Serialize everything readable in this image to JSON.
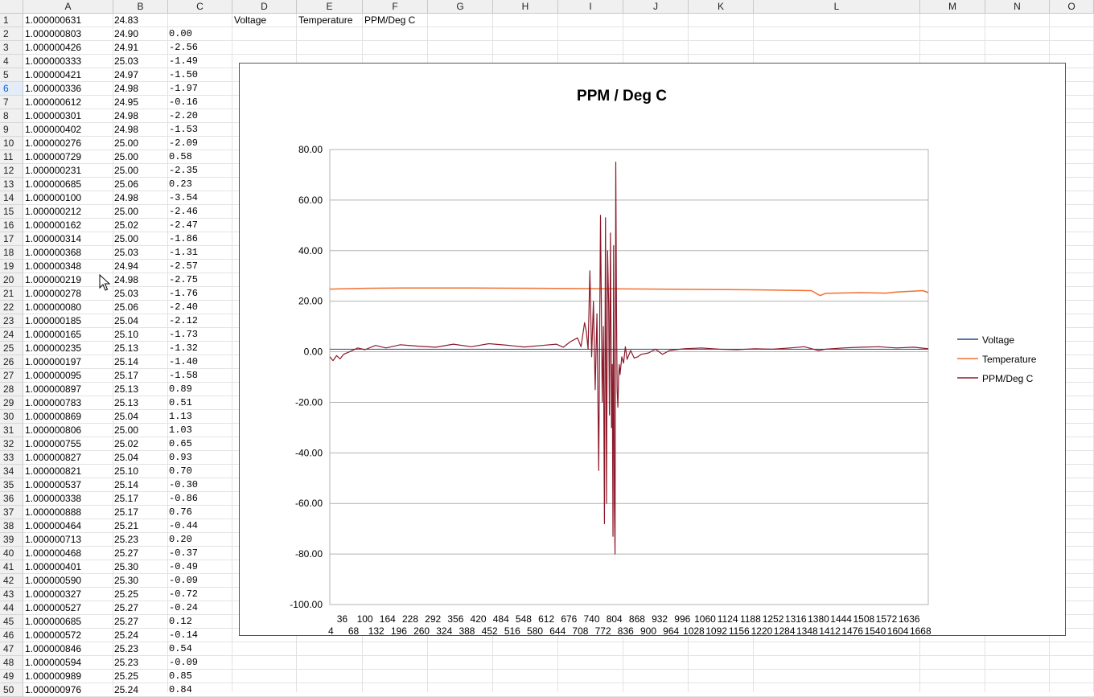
{
  "columns": [
    "A",
    "B",
    "C",
    "D",
    "E",
    "F",
    "G",
    "H",
    "I",
    "J",
    "K",
    "L",
    "M",
    "N",
    "O"
  ],
  "header_row": {
    "D": "Voltage",
    "E": "Temperature",
    "F": "PPM/Deg C"
  },
  "active_row": 6,
  "rows": [
    {
      "n": "1",
      "a": "1.000000631",
      "b": "24.83",
      "c": ""
    },
    {
      "n": "2",
      "a": "1.000000803",
      "b": "24.90",
      "c": "0.00"
    },
    {
      "n": "3",
      "a": "1.000000426",
      "b": "24.91",
      "c": "-2.56"
    },
    {
      "n": "4",
      "a": "1.000000333",
      "b": "25.03",
      "c": "-1.49"
    },
    {
      "n": "5",
      "a": "1.000000421",
      "b": "24.97",
      "c": "-1.50"
    },
    {
      "n": "6",
      "a": "1.000000336",
      "b": "24.98",
      "c": "-1.97"
    },
    {
      "n": "7",
      "a": "1.000000612",
      "b": "24.95",
      "c": "-0.16"
    },
    {
      "n": "8",
      "a": "1.000000301",
      "b": "24.98",
      "c": "-2.20"
    },
    {
      "n": "9",
      "a": "1.000000402",
      "b": "24.98",
      "c": "-1.53"
    },
    {
      "n": "10",
      "a": "1.000000276",
      "b": "25.00",
      "c": "-2.09"
    },
    {
      "n": "11",
      "a": "1.000000729",
      "b": "25.00",
      "c": "0.58"
    },
    {
      "n": "12",
      "a": "1.000000231",
      "b": "25.00",
      "c": "-2.35"
    },
    {
      "n": "13",
      "a": "1.000000685",
      "b": "25.06",
      "c": "0.23"
    },
    {
      "n": "14",
      "a": "1.000000100",
      "b": "24.98",
      "c": "-3.54"
    },
    {
      "n": "15",
      "a": "1.000000212",
      "b": "25.00",
      "c": "-2.46"
    },
    {
      "n": "16",
      "a": "1.000000162",
      "b": "25.02",
      "c": "-2.47"
    },
    {
      "n": "17",
      "a": "1.000000314",
      "b": "25.00",
      "c": "-1.86"
    },
    {
      "n": "18",
      "a": "1.000000368",
      "b": "25.03",
      "c": "-1.31"
    },
    {
      "n": "19",
      "a": "1.000000348",
      "b": "24.94",
      "c": "-2.57"
    },
    {
      "n": "20",
      "a": "1.000000219",
      "b": "24.98",
      "c": "-2.75"
    },
    {
      "n": "21",
      "a": "1.000000278",
      "b": "25.03",
      "c": "-1.76"
    },
    {
      "n": "22",
      "a": "1.000000080",
      "b": "25.06",
      "c": "-2.40"
    },
    {
      "n": "23",
      "a": "1.000000185",
      "b": "25.04",
      "c": "-2.12"
    },
    {
      "n": "24",
      "a": "1.000000165",
      "b": "25.10",
      "c": "-1.73"
    },
    {
      "n": "25",
      "a": "1.000000235",
      "b": "25.13",
      "c": "-1.32"
    },
    {
      "n": "26",
      "a": "1.000000197",
      "b": "25.14",
      "c": "-1.40"
    },
    {
      "n": "27",
      "a": "1.000000095",
      "b": "25.17",
      "c": "-1.58"
    },
    {
      "n": "28",
      "a": "1.000000897",
      "b": "25.13",
      "c": "0.89"
    },
    {
      "n": "29",
      "a": "1.000000783",
      "b": "25.13",
      "c": "0.51"
    },
    {
      "n": "30",
      "a": "1.000000869",
      "b": "25.04",
      "c": "1.13"
    },
    {
      "n": "31",
      "a": "1.000000806",
      "b": "25.00",
      "c": "1.03"
    },
    {
      "n": "32",
      "a": "1.000000755",
      "b": "25.02",
      "c": "0.65"
    },
    {
      "n": "33",
      "a": "1.000000827",
      "b": "25.04",
      "c": "0.93"
    },
    {
      "n": "34",
      "a": "1.000000821",
      "b": "25.10",
      "c": "0.70"
    },
    {
      "n": "35",
      "a": "1.000000537",
      "b": "25.14",
      "c": "-0.30"
    },
    {
      "n": "36",
      "a": "1.000000338",
      "b": "25.17",
      "c": "-0.86"
    },
    {
      "n": "37",
      "a": "1.000000888",
      "b": "25.17",
      "c": "0.76"
    },
    {
      "n": "38",
      "a": "1.000000464",
      "b": "25.21",
      "c": "-0.44"
    },
    {
      "n": "39",
      "a": "1.000000713",
      "b": "25.23",
      "c": "0.20"
    },
    {
      "n": "40",
      "a": "1.000000468",
      "b": "25.27",
      "c": "-0.37"
    },
    {
      "n": "41",
      "a": "1.000000401",
      "b": "25.30",
      "c": "-0.49"
    },
    {
      "n": "42",
      "a": "1.000000590",
      "b": "25.30",
      "c": "-0.09"
    },
    {
      "n": "43",
      "a": "1.000000327",
      "b": "25.25",
      "c": "-0.72"
    },
    {
      "n": "44",
      "a": "1.000000527",
      "b": "25.27",
      "c": "-0.24"
    },
    {
      "n": "45",
      "a": "1.000000685",
      "b": "25.27",
      "c": "0.12"
    },
    {
      "n": "46",
      "a": "1.000000572",
      "b": "25.24",
      "c": "-0.14"
    },
    {
      "n": "47",
      "a": "1.000000846",
      "b": "25.23",
      "c": "0.54"
    },
    {
      "n": "48",
      "a": "1.000000594",
      "b": "25.23",
      "c": "-0.09"
    },
    {
      "n": "49",
      "a": "1.000000989",
      "b": "25.25",
      "c": "0.85"
    },
    {
      "n": "50",
      "a": "1.000000976",
      "b": "25.24",
      "c": "0.84"
    }
  ],
  "chart_data": {
    "type": "line",
    "title": "PPM / Deg C",
    "xlabel": "",
    "ylabel": "",
    "ylim": [
      -100,
      80
    ],
    "yticks": [
      80,
      60,
      40,
      20,
      0,
      -20,
      -40,
      -60,
      -80,
      -100
    ],
    "ytick_labels": [
      "80.00",
      "60.00",
      "40.00",
      "20.00",
      "0.00",
      "-20.00",
      "-40.00",
      "-60.00",
      "-80.00",
      "-100.00"
    ],
    "xlim": [
      1,
      1690
    ],
    "xticks_top": [
      36,
      100,
      164,
      228,
      292,
      356,
      420,
      484,
      548,
      612,
      676,
      740,
      804,
      868,
      932,
      996,
      1060,
      1124,
      1188,
      1252,
      1316,
      1380,
      1444,
      1508,
      1572,
      1636
    ],
    "xticks_bottom": [
      4,
      68,
      132,
      196,
      260,
      324,
      388,
      452,
      516,
      580,
      644,
      708,
      772,
      836,
      900,
      964,
      1028,
      1092,
      1156,
      1220,
      1284,
      1348,
      1412,
      1476,
      1540,
      1604,
      1668
    ],
    "grid": true,
    "legend": "right",
    "series": [
      {
        "name": "Voltage",
        "color": "#1f4e8c",
        "x": [
          1,
          400,
          800,
          1200,
          1690
        ],
        "y": [
          1.0,
          1.0,
          1.0,
          1.0,
          1.0
        ]
      },
      {
        "name": "Temperature",
        "color": "#f07030",
        "x": [
          1,
          100,
          200,
          400,
          600,
          800,
          1000,
          1200,
          1300,
          1360,
          1375,
          1385,
          1400,
          1500,
          1570,
          1600,
          1650,
          1675,
          1690
        ],
        "y": [
          24.8,
          25.1,
          25.2,
          25.2,
          25.1,
          24.9,
          24.7,
          24.5,
          24.3,
          24.2,
          23.0,
          22.2,
          23.1,
          23.4,
          23.2,
          23.6,
          24.0,
          24.2,
          23.4
        ],
        "line_width": 1.5
      },
      {
        "name": "PPM/Deg C",
        "color": "#8b1a2b",
        "x": [
          1,
          10,
          20,
          30,
          40,
          60,
          80,
          100,
          130,
          160,
          200,
          250,
          300,
          350,
          400,
          450,
          500,
          550,
          600,
          640,
          660,
          680,
          700,
          710,
          720,
          725,
          730,
          735,
          740,
          745,
          750,
          755,
          760,
          765,
          770,
          773,
          776,
          779,
          782,
          785,
          788,
          790,
          793,
          796,
          798,
          800,
          802,
          804,
          806,
          808,
          810,
          812,
          814,
          816,
          818,
          820,
          825,
          830,
          835,
          840,
          850,
          860,
          870,
          880,
          900,
          920,
          940,
          960,
          1000,
          1050,
          1100,
          1150,
          1200,
          1250,
          1300,
          1340,
          1380,
          1400,
          1450,
          1500,
          1550,
          1600,
          1650,
          1690
        ],
        "y": [
          -2.0,
          -3.5,
          -1.5,
          -2.8,
          -1.0,
          0.2,
          1.5,
          0.8,
          2.5,
          1.5,
          2.8,
          2.2,
          1.8,
          3.0,
          2.0,
          3.2,
          2.6,
          1.9,
          2.5,
          3.0,
          1.8,
          4.0,
          5.5,
          2.0,
          11.5,
          8.0,
          1.0,
          32.0,
          -2.0,
          20.0,
          -15.0,
          15.0,
          -47.0,
          54.0,
          -20.0,
          10.0,
          -68.0,
          53.0,
          -60.0,
          40.0,
          18.0,
          -25.0,
          47.0,
          -30.0,
          -5.0,
          -73.0,
          42.0,
          -60.0,
          -80.0,
          75.0,
          15.0,
          -15.0,
          -22.0,
          -10.0,
          -5.0,
          -9.0,
          -2.0,
          -4.5,
          2.0,
          -3.0,
          0.5,
          -2.5,
          -2.0,
          -1.0,
          -0.5,
          1.0,
          -1.0,
          0.5,
          1.2,
          1.5,
          1.0,
          0.8,
          1.2,
          1.0,
          1.5,
          2.0,
          0.5,
          1.0,
          1.5,
          1.8,
          2.0,
          1.5,
          1.8,
          1.2
        ],
        "line_width": 1.2
      }
    ]
  }
}
